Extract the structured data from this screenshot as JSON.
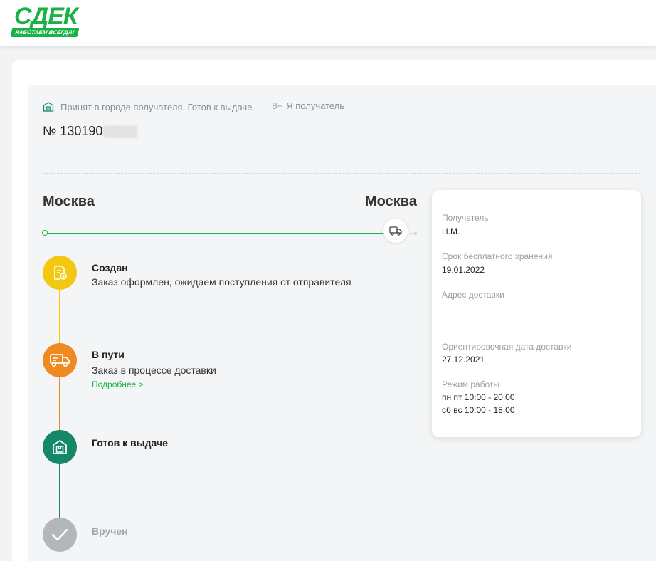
{
  "header": {
    "logo_text": "СДЕК",
    "logo_slogan": "РАБОТАЕМ ВСЕГДА!"
  },
  "status": {
    "icon": "warehouse-icon",
    "text": "Принят в городе получателя. Готов к выдаче",
    "recipient_icon": "add-person-icon",
    "recipient_label": "Я получатель"
  },
  "order": {
    "number_prefix": "№ 130190"
  },
  "route": {
    "from_city": "Москва",
    "to_city": "Москва",
    "color": "#1ab248"
  },
  "steps": [
    {
      "title": "Создан",
      "description": "Заказ оформлен, ожидаем поступления от отправителя",
      "icon": "document-add-icon",
      "color": "#f2c811"
    },
    {
      "title": "В пути",
      "description": "Заказ в процессе доставки",
      "more": "Подробнее >",
      "icon": "truck-icon",
      "color": "#ee8a1f"
    },
    {
      "title": "Готов к выдаче",
      "icon": "warehouse-box-icon",
      "color": "#15886a"
    },
    {
      "title": "Вручен",
      "icon": "checkmark-icon",
      "color": "#b4b7ba"
    }
  ],
  "info": {
    "recipient_label": "Получатель",
    "recipient_value": "Н.М.",
    "storage_label": "Срок бесплатного хранения",
    "storage_value": "19.01.2022",
    "address_label": "Адрес доставки",
    "delivery_date_label": "Ориентировочная дата доставки",
    "delivery_date_value": "27.12.2021",
    "hours_label": "Режим работы",
    "hours_weekdays": "пн пт 10:00 - 20:00",
    "hours_weekend": "сб вс 10:00 - 18:00"
  }
}
